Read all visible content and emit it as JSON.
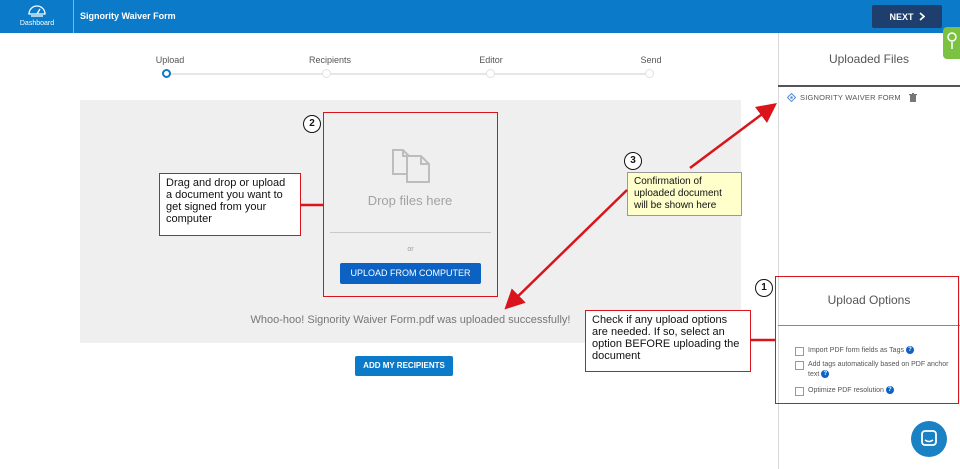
{
  "header": {
    "dashboard_label": "Dashboard",
    "title": "Signority Waiver Form",
    "next_label": "NEXT"
  },
  "steps": [
    {
      "label": "Upload",
      "active": true
    },
    {
      "label": "Recipients",
      "active": false
    },
    {
      "label": "Editor",
      "active": false
    },
    {
      "label": "Send",
      "active": false
    }
  ],
  "upload": {
    "drop_text": "Drop files here",
    "or_text": "or",
    "button_label": "UPLOAD FROM COMPUTER",
    "success_message": "Whoo-hoo! Signority Waiver Form.pdf was uploaded successfully!",
    "recipients_button": "ADD MY RECIPIENTS"
  },
  "uploaded_files": {
    "title": "Uploaded Files",
    "files": [
      "SIGNORITY WAIVER FORM"
    ]
  },
  "upload_options": {
    "title": "Upload Options",
    "options": [
      {
        "label": "Import PDF form fields as Tags",
        "checked": false
      },
      {
        "label": "Add tags automatically based on PDF anchor text",
        "checked": false
      },
      {
        "label": "Optimize PDF resolution",
        "checked": false
      }
    ]
  },
  "annotations": {
    "n1": "1",
    "n2": "2",
    "n3": "3",
    "drag_drop": "Drag and drop or upload a document you want to get signed from your computer",
    "confirmation": "Confirmation of uploaded document will be shown here",
    "check_options": "Check if any upload options are needed. If so, select an option BEFORE uploading the document"
  },
  "colors": {
    "brand_blue": "#0b7ac9",
    "next_button": "#1e3e6e",
    "annotation_red": "#d9141b",
    "callout_yellow": "#ffffcc"
  }
}
